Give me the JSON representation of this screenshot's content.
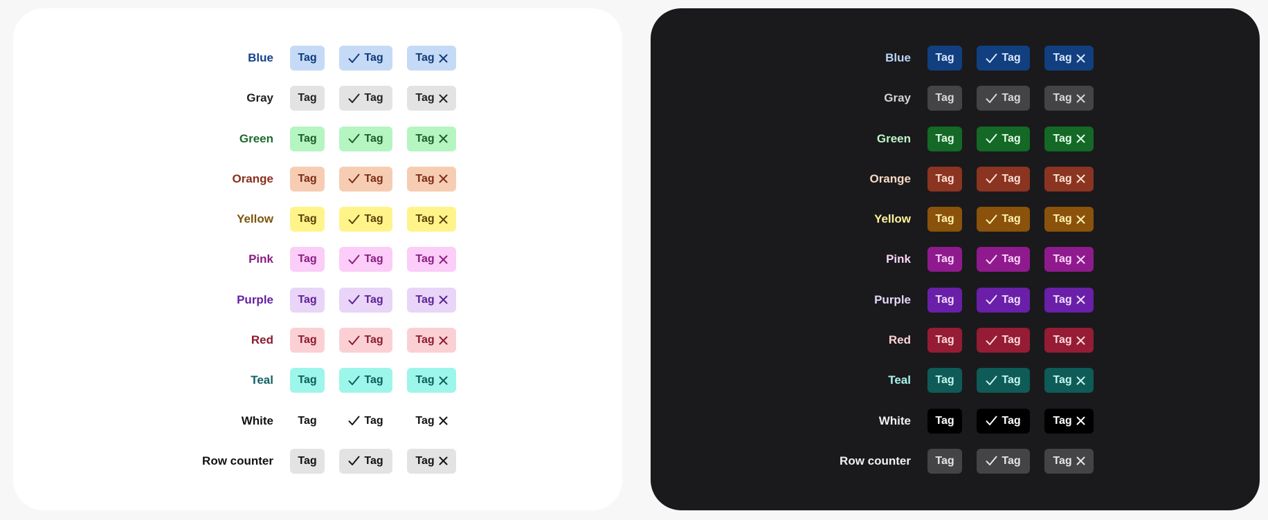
{
  "tag_label": "Tag",
  "panels": [
    {
      "theme": "light",
      "rows": [
        {
          "label": "Blue",
          "label_color": "#14428b",
          "bg": "#c5daf6",
          "fg": "#0f3a78"
        },
        {
          "label": "Gray",
          "label_color": "#222222",
          "bg": "#e3e3e4",
          "fg": "#222222"
        },
        {
          "label": "Green",
          "label_color": "#1d6a2f",
          "bg": "#b5f5c2",
          "fg": "#1d5b2b"
        },
        {
          "label": "Orange",
          "label_color": "#8b2e1b",
          "bg": "#f6cdb3",
          "fg": "#7d2a16"
        },
        {
          "label": "Yellow",
          "label_color": "#7d5407",
          "bg": "#fff48a",
          "fg": "#5e4008"
        },
        {
          "label": "Pink",
          "label_color": "#8a1d83",
          "bg": "#fbcdf8",
          "fg": "#8a1d83"
        },
        {
          "label": "Purple",
          "label_color": "#6420a3",
          "bg": "#e8d5f8",
          "fg": "#5d1f97"
        },
        {
          "label": "Red",
          "label_color": "#8b1a2f",
          "bg": "#fbd0d4",
          "fg": "#8b1a2f"
        },
        {
          "label": "Teal",
          "label_color": "#116063",
          "bg": "#9df6ea",
          "fg": "#0f5b58"
        },
        {
          "label": "White",
          "label_color": "#111111",
          "bg": "#ffffff",
          "fg": "#111111"
        },
        {
          "label": "Row counter",
          "label_color": "#111111",
          "bg": "#e3e3e4",
          "fg": "#111111"
        }
      ]
    },
    {
      "theme": "dark",
      "rows": [
        {
          "label": "Blue",
          "label_color": "#b9d3f7",
          "bg": "#113f80",
          "fg": "#dbe8fb"
        },
        {
          "label": "Gray",
          "label_color": "#d4d4d6",
          "bg": "#444446",
          "fg": "#d8d8da"
        },
        {
          "label": "Green",
          "label_color": "#bff5cb",
          "bg": "#136925",
          "fg": "#e5fbe9"
        },
        {
          "label": "Orange",
          "label_color": "#f8d9c2",
          "bg": "#8b3421",
          "fg": "#fbe1d2"
        },
        {
          "label": "Yellow",
          "label_color": "#fff39a",
          "bg": "#8a520b",
          "fg": "#fff4b0"
        },
        {
          "label": "Pink",
          "label_color": "#fad4f6",
          "bg": "#8f1a8e",
          "fg": "#fbd8f8"
        },
        {
          "label": "Purple",
          "label_color": "#e5d6f8",
          "bg": "#6a1fa8",
          "fg": "#efe0fb"
        },
        {
          "label": "Red",
          "label_color": "#fbd4d8",
          "bg": "#951c34",
          "fg": "#fbd9dd"
        },
        {
          "label": "Teal",
          "label_color": "#a9f5ec",
          "bg": "#0e5b57",
          "fg": "#c4f7f0"
        },
        {
          "label": "White",
          "label_color": "#f1f1f1",
          "bg": "#000000",
          "fg": "#ffffff"
        },
        {
          "label": "Row counter",
          "label_color": "#f1f1f1",
          "bg": "#444446",
          "fg": "#e6e6e8"
        }
      ]
    }
  ]
}
